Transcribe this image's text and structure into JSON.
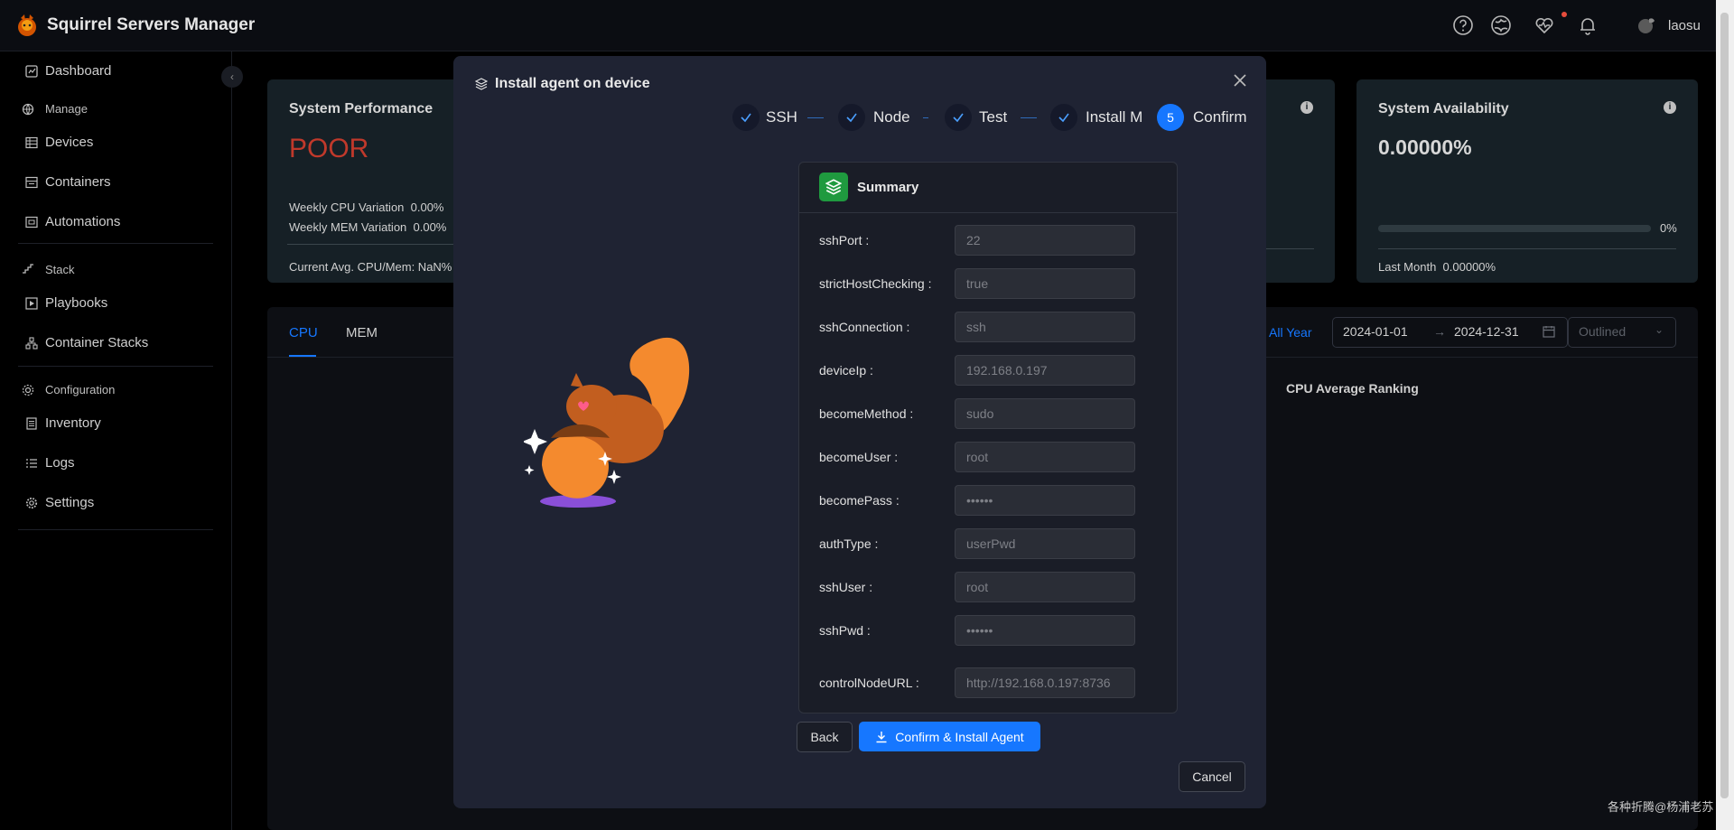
{
  "app": {
    "title": "Squirrel Servers Manager",
    "user": "laosu"
  },
  "header_icons": [
    "question-icon",
    "globe-icon",
    "heartbeat-icon",
    "bell-icon",
    "avatar-icon"
  ],
  "sidebar": {
    "items": [
      {
        "label": "Dashboard",
        "icon": "dashboard-icon"
      },
      {
        "label": "Devices",
        "icon": "table-icon"
      },
      {
        "label": "Containers",
        "icon": "container-icon"
      },
      {
        "label": "Automations",
        "icon": "automation-icon"
      },
      {
        "label": "Playbooks",
        "icon": "play-square-icon"
      },
      {
        "label": "Container Stacks",
        "icon": "stacks-icon"
      },
      {
        "label": "Inventory",
        "icon": "inventory-icon"
      },
      {
        "label": "Logs",
        "icon": "list-icon"
      },
      {
        "label": "Settings",
        "icon": "gear-icon"
      }
    ],
    "groups": [
      {
        "label": "Manage",
        "icon": "globe-icon"
      },
      {
        "label": "Stack",
        "icon": "stack-icon"
      },
      {
        "label": "Configuration",
        "icon": "config-icon"
      }
    ]
  },
  "dashboard": {
    "perf": {
      "title": "System Performance",
      "status": "POOR",
      "cpu_variation": "Weekly CPU Variation  0.00%",
      "mem_variation": "Weekly MEM Variation  0.00%",
      "current_avg": "Current Avg. CPU/Mem: NaN%"
    },
    "availability": {
      "title": "System Availability",
      "value": "0.00000%",
      "progress_label": "0%",
      "progress": 0,
      "last_month": "Last Month  0.00000%"
    },
    "tabs": [
      "CPU",
      "MEM"
    ],
    "range_all_year": "All Year",
    "date_start": "2024-01-01",
    "date_end": "2024-12-31",
    "select_value": "Outlined",
    "ranking_title": "CPU Average Ranking"
  },
  "modal": {
    "title": "Install agent on device",
    "steps": [
      {
        "label": "SSH",
        "status": "done"
      },
      {
        "label": "Node",
        "status": "done"
      },
      {
        "label": "Test",
        "status": "done"
      },
      {
        "label": "Install Mo",
        "status": "done"
      },
      {
        "label": "Confirm",
        "status": "current",
        "number": "5"
      }
    ],
    "summary_title": "Summary",
    "fields": [
      {
        "label": "sshPort :",
        "value": "22"
      },
      {
        "label": "strictHostChecking :",
        "value": "true"
      },
      {
        "label": "sshConnection :",
        "value": "ssh"
      },
      {
        "label": "deviceIp :",
        "value": "192.168.0.197"
      },
      {
        "label": "becomeMethod :",
        "value": "sudo"
      },
      {
        "label": "becomeUser :",
        "value": "root"
      },
      {
        "label": "becomePass :",
        "value": "••••••"
      },
      {
        "label": "authType :",
        "value": "userPwd"
      },
      {
        "label": "sshUser :",
        "value": "root"
      },
      {
        "label": "sshPwd :",
        "value": "••••••"
      },
      {
        "label": "controlNodeURL :",
        "value": "http://192.168.0.197:8736"
      }
    ],
    "back_label": "Back",
    "confirm_label": "Confirm & Install Agent",
    "cancel_label": "Cancel"
  },
  "watermark": "各种折腾@杨浦老苏",
  "colors": {
    "accent": "#1677ff",
    "poor": "#c0392b",
    "success": "#1f9a3f"
  }
}
